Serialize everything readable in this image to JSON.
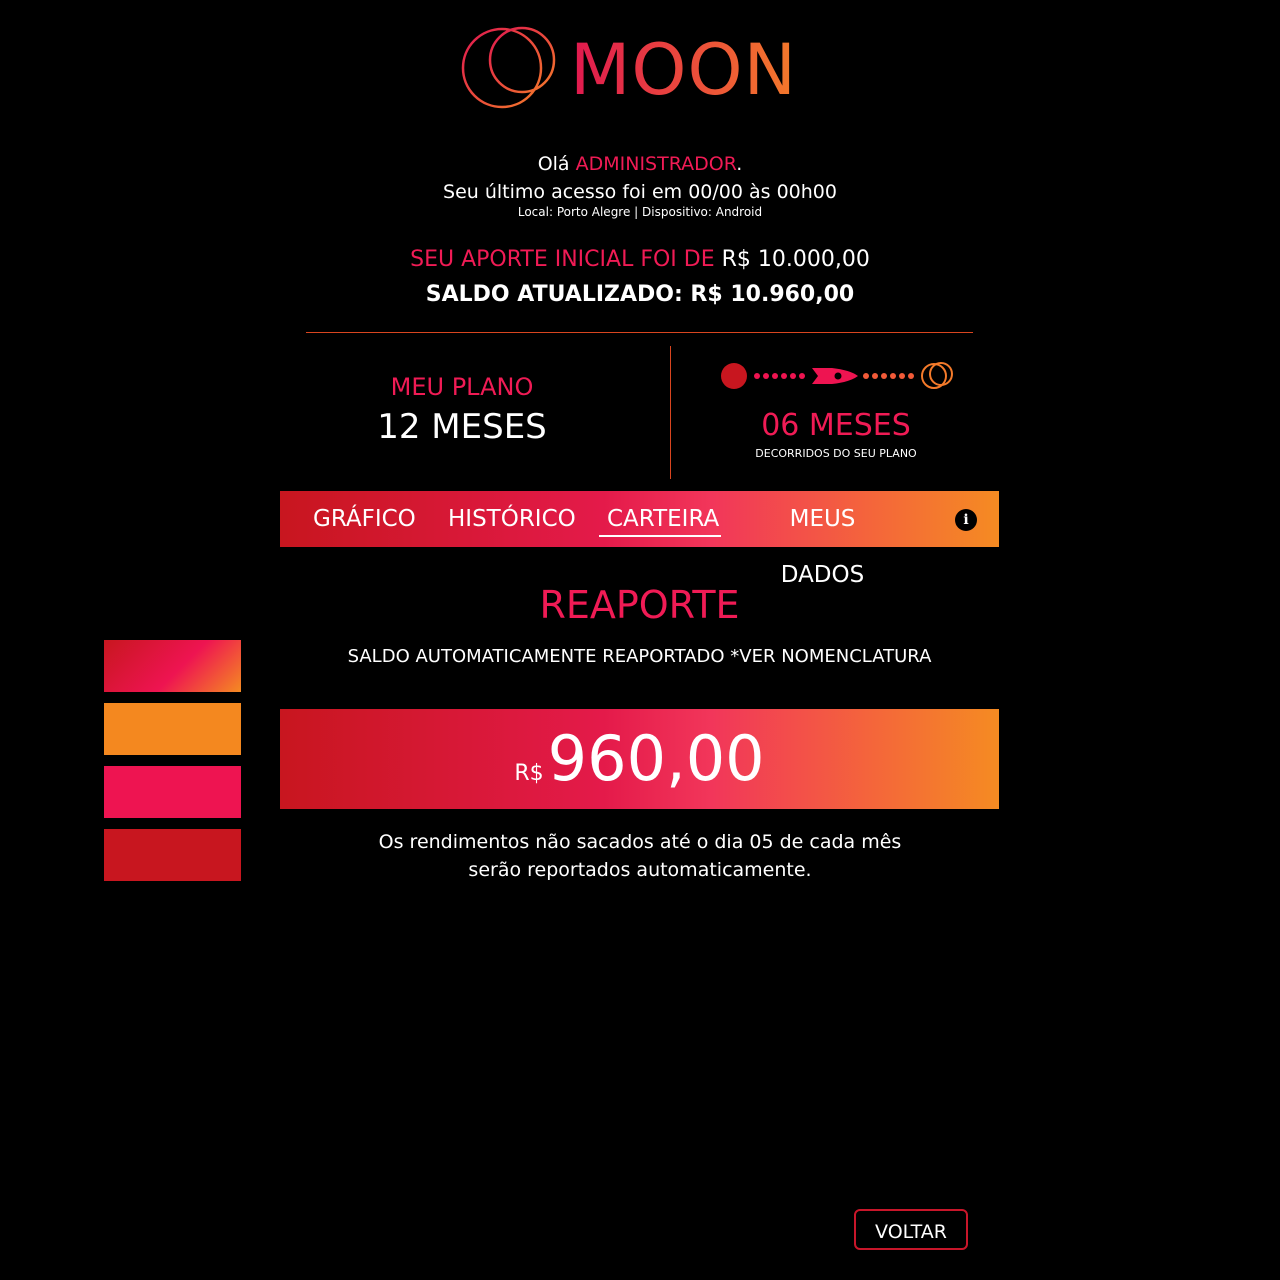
{
  "brand": {
    "name": "MOON"
  },
  "header": {
    "greeting_prefix": "Olá ",
    "user_name": "ADMINISTRADOR",
    "greeting_suffix": ".",
    "last_access": "Seu último acesso foi em 00/00 às 00h00",
    "device_info": "Local: Porto Alegre | Dispositivo: Android"
  },
  "summary": {
    "initial_label": "SEU APORTE INICIAL FOI DE",
    "initial_value": "R$ 10.000,00",
    "balance": "SALDO ATUALIZADO: R$ 10.960,00"
  },
  "plan": {
    "label": "MEU PLANO",
    "value": "12 MESES",
    "elapsed_value": "06 MESES",
    "elapsed_label": "DECORRIDOS DO SEU PLANO",
    "progress_fraction": 0.5
  },
  "tabs": [
    {
      "label": "GRÁFICO",
      "active": false
    },
    {
      "label": "HISTÓRICO",
      "active": false
    },
    {
      "label": "CARTEIRA",
      "active": true
    },
    {
      "label": "MEUS DADOS",
      "active": false
    }
  ],
  "icons": {
    "info": "info-icon",
    "progress": "rocket-icon"
  },
  "section": {
    "title": "REAPORTE",
    "subtitle": "SALDO AUTOMATICAMENTE REAPORTADO *VER NOMENCLATURA",
    "currency": "R$",
    "amount": "960,00",
    "note_line1": "Os rendimentos não sacados até o dia 05 de cada mês",
    "note_line2": "serão reportados automaticamente."
  },
  "swatches": [
    "gradient #c8161f→#f58b22",
    "#f4881f",
    "#ee1451",
    "#c8161f"
  ],
  "colors": {
    "accent": "#f01b55",
    "red": "#c8161f",
    "orange": "#f58b22"
  },
  "footer": {
    "back_label": "VOLTAR"
  }
}
